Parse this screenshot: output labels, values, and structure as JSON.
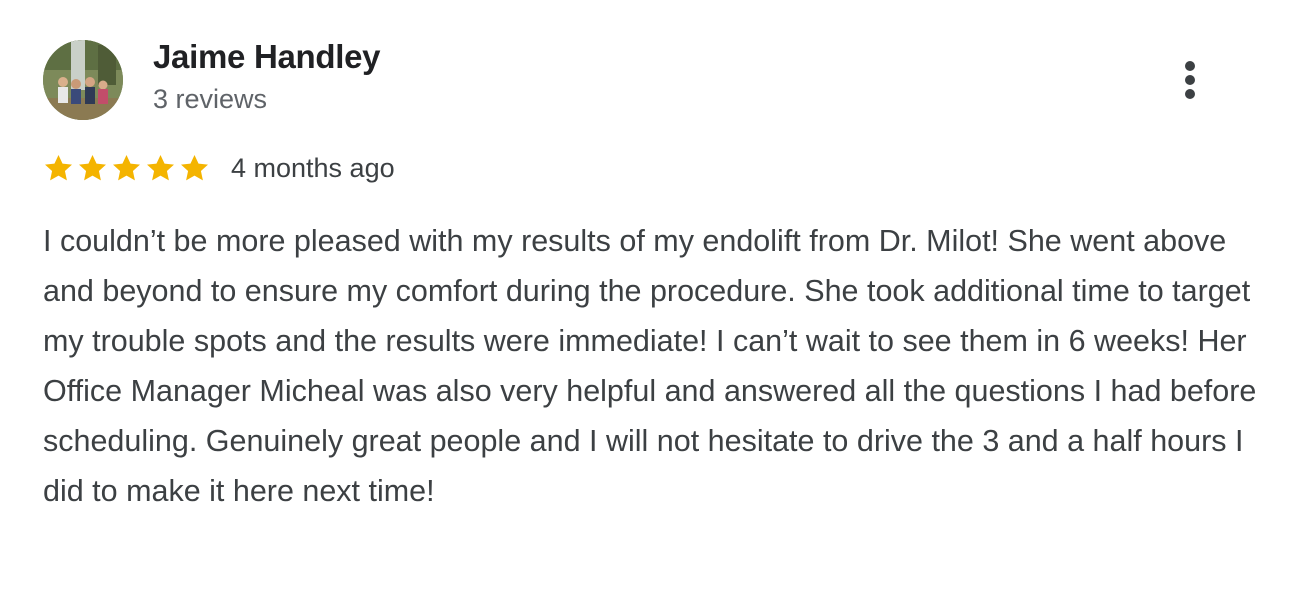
{
  "review": {
    "reviewer_name": "Jaime Handley",
    "review_count": "3 reviews",
    "rating": 5,
    "rating_max": 5,
    "time_ago": "4 months ago",
    "text": "I couldn’t be more pleased with my results of my endolift from Dr. Milot! She went above and beyond to ensure my comfort during the procedure. She took additional time to target my trouble spots and the results were immediate! I can’t wait to see them in 6 weeks! Her Office Manager Micheal was also very helpful and answered all the questions I had before scheduling. Genuinely great people and I will not hesitate to drive the 3 and a half hours I did to make it here next time!"
  },
  "icons": {
    "avatar": "avatar-photo",
    "more": "more-vert-icon",
    "star": "star-icon"
  },
  "colors": {
    "star": "#f4b400",
    "name": "#202124",
    "text": "#3c4043",
    "secondary": "#5f6368"
  }
}
